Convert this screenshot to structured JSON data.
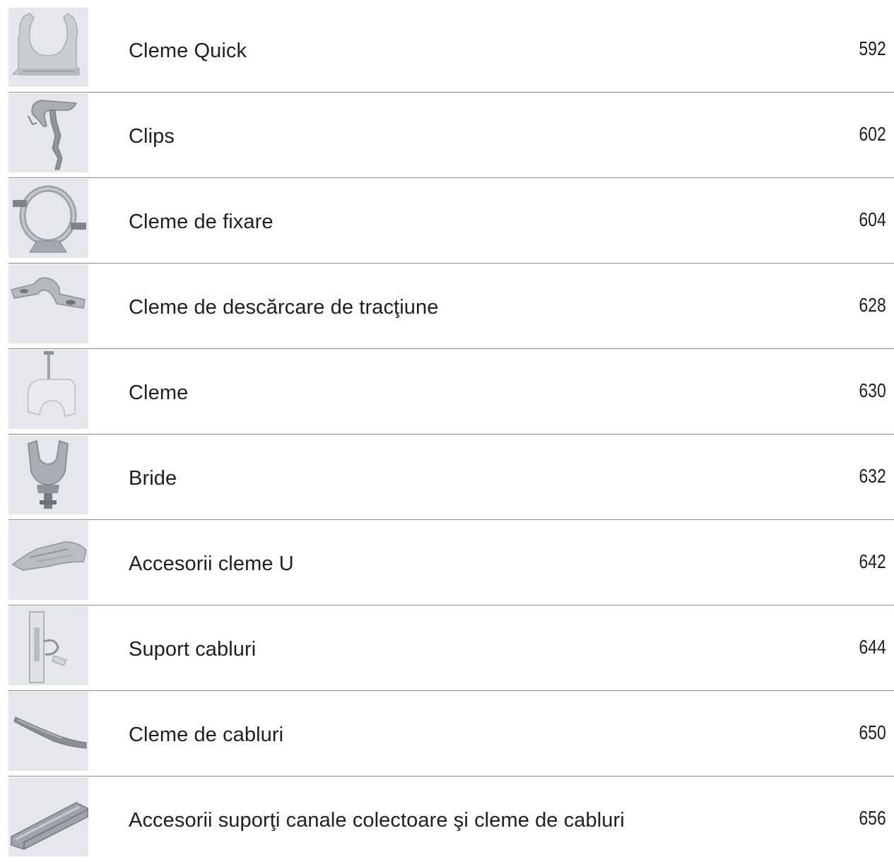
{
  "entries": [
    {
      "title": "Cleme Quick",
      "page": "592",
      "icon": "quick-clamp-icon"
    },
    {
      "title": "Clips",
      "page": "602",
      "icon": "clip-icon"
    },
    {
      "title": "Cleme de fixare",
      "page": "604",
      "icon": "fixing-clamp-icon"
    },
    {
      "title": "Cleme de descărcare de tracţiune",
      "page": "628",
      "icon": "strain-relief-clamp-icon"
    },
    {
      "title": "Cleme",
      "page": "630",
      "icon": "nail-clip-icon"
    },
    {
      "title": "Bride",
      "page": "632",
      "icon": "bracket-icon"
    },
    {
      "title": "Accesorii cleme U",
      "page": "642",
      "icon": "u-clamp-accessory-icon"
    },
    {
      "title": "Suport cabluri",
      "page": "644",
      "icon": "cable-support-icon"
    },
    {
      "title": "Cleme de cabluri",
      "page": "650",
      "icon": "cable-clamp-icon"
    },
    {
      "title": "Accesorii suporţi canale colectoare şi cleme de cabluri",
      "page": "656",
      "icon": "channel-accessory-icon"
    }
  ],
  "colors": {
    "thumb_background": "#e4e8ec",
    "divider": "#7d8c97",
    "text": "#1f1f1f"
  }
}
